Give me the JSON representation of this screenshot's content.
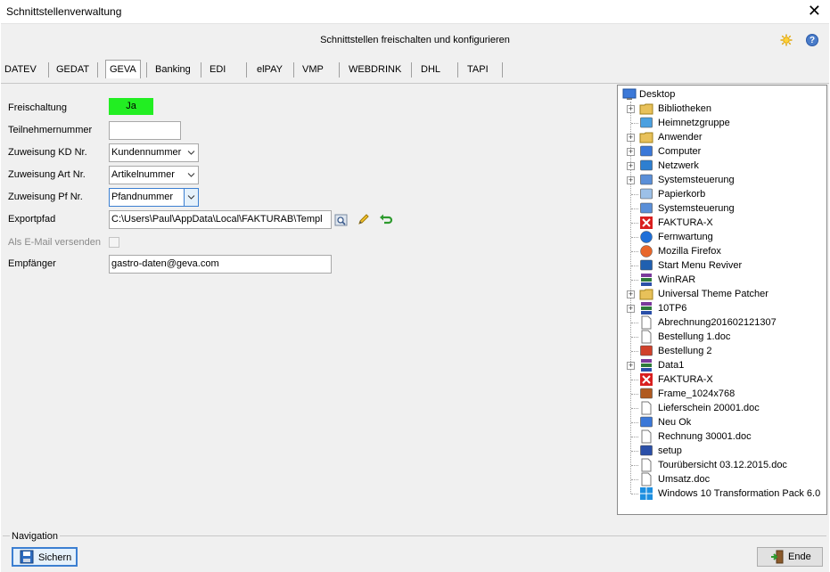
{
  "window": {
    "title": "Schnittstellenverwaltung",
    "close_glyph": "✕"
  },
  "header": {
    "text": "Schnittstellen freischalten und konfigurieren",
    "icons": [
      "sun-icon",
      "help-icon"
    ],
    "help_glyph": "?"
  },
  "tabs": [
    "DATEV",
    "GEDAT",
    "GEVA",
    "Banking",
    "EDI",
    "elPAY",
    "VMP",
    "WEBDRINK",
    "DHL",
    "TAPI"
  ],
  "active_tab": "GEVA",
  "form": {
    "freischaltung_label": "Freischaltung",
    "freischaltung_value": "Ja",
    "freischaltung_color": "#22ee22",
    "teilnehmer_label": "Teilnehmernummer",
    "teilnehmer_value": "",
    "kd_label": "Zuweisung KD Nr.",
    "kd_value": "Kundennummer",
    "art_label": "Zuweisung Art Nr.",
    "art_value": "Artikelnummer",
    "pf_label": "Zuweisung Pf Nr.",
    "pf_value": "Pfandnummer",
    "export_label": "Exportpfad",
    "export_value": "C:\\Users\\Paul\\AppData\\Local\\FAKTURAB\\Templ",
    "email_label": "Als E-Mail versenden",
    "email_checked": false,
    "recipient_label": "Empfänger",
    "recipient_value": "gastro-daten@geva.com"
  },
  "tree": {
    "root": "Desktop",
    "items": [
      {
        "label": "Bibliotheken",
        "expandable": true,
        "icon": "library-icon"
      },
      {
        "label": "Heimnetzgruppe",
        "expandable": false,
        "icon": "homegroup-icon"
      },
      {
        "label": "Anwender",
        "expandable": true,
        "icon": "user-folder-icon"
      },
      {
        "label": "Computer",
        "expandable": true,
        "icon": "computer-icon"
      },
      {
        "label": "Netzwerk",
        "expandable": true,
        "icon": "network-icon"
      },
      {
        "label": "Systemsteuerung",
        "expandable": true,
        "icon": "control-panel-icon"
      },
      {
        "label": "Papierkorb",
        "expandable": false,
        "icon": "recycle-bin-icon"
      },
      {
        "label": "Systemsteuerung",
        "expandable": false,
        "icon": "control-panel-icon"
      },
      {
        "label": "FAKTURA-X",
        "expandable": false,
        "icon": "faktura-icon"
      },
      {
        "label": "Fernwartung",
        "expandable": false,
        "icon": "teamviewer-icon"
      },
      {
        "label": "Mozilla Firefox",
        "expandable": false,
        "icon": "firefox-icon"
      },
      {
        "label": "Start Menu Reviver",
        "expandable": false,
        "icon": "app-icon"
      },
      {
        "label": "WinRAR",
        "expandable": false,
        "icon": "winrar-icon"
      },
      {
        "label": "Universal Theme Patcher",
        "expandable": true,
        "icon": "folder-icon"
      },
      {
        "label": "10TP6",
        "expandable": true,
        "icon": "winrar-icon"
      },
      {
        "label": "Abrechnung201602121307",
        "expandable": false,
        "icon": "file-icon"
      },
      {
        "label": "Bestellung 1.doc",
        "expandable": false,
        "icon": "file-icon"
      },
      {
        "label": "Bestellung 2",
        "expandable": false,
        "icon": "pdf-icon"
      },
      {
        "label": "Data1",
        "expandable": true,
        "icon": "winrar-icon"
      },
      {
        "label": "FAKTURA-X",
        "expandable": false,
        "icon": "faktura-icon"
      },
      {
        "label": "Frame_1024x768",
        "expandable": false,
        "icon": "image-icon"
      },
      {
        "label": "Lieferschein 20001.doc",
        "expandable": false,
        "icon": "file-icon"
      },
      {
        "label": "Neu Ok",
        "expandable": false,
        "icon": "window-icon"
      },
      {
        "label": "Rechnung 30001.doc",
        "expandable": false,
        "icon": "file-icon"
      },
      {
        "label": "setup",
        "expandable": false,
        "icon": "setup-icon"
      },
      {
        "label": "Tourübersicht 03.12.2015.doc",
        "expandable": false,
        "icon": "file-icon"
      },
      {
        "label": "Umsatz.doc",
        "expandable": false,
        "icon": "file-icon"
      },
      {
        "label": "Windows 10 Transformation Pack 6.0",
        "expandable": false,
        "icon": "windows-icon"
      }
    ]
  },
  "navigation": {
    "label": "Navigation",
    "save_label": "Sichern",
    "end_label": "Ende"
  }
}
